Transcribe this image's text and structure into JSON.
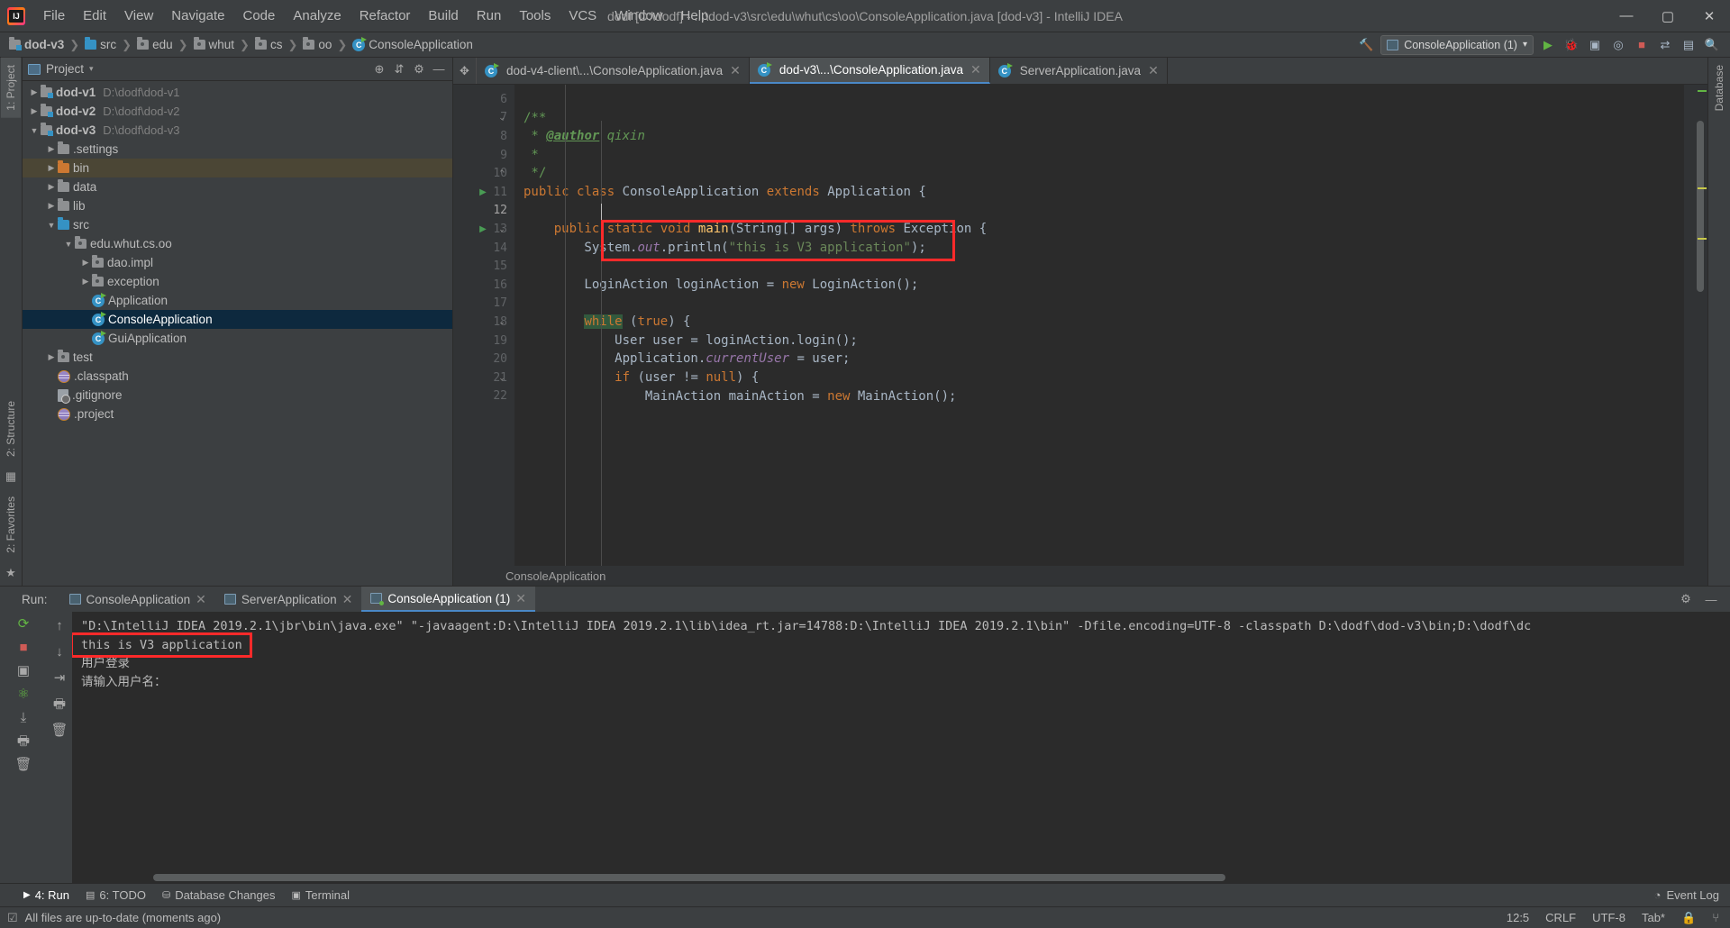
{
  "window": {
    "title": "dodf [D:\\dodf] - ...\\dod-v3\\src\\edu\\whut\\cs\\oo\\ConsoleApplication.java [dod-v3] - IntelliJ IDEA",
    "minimize": "—",
    "maximize": "▢",
    "close": "✕"
  },
  "menu": [
    "File",
    "Edit",
    "View",
    "Navigate",
    "Code",
    "Analyze",
    "Refactor",
    "Build",
    "Run",
    "Tools",
    "VCS",
    "Window",
    "Help"
  ],
  "breadcrumb": {
    "items": [
      {
        "label": "dod-v3",
        "icon": "module-folder-icon"
      },
      {
        "label": "src",
        "icon": "source-folder-icon"
      },
      {
        "label": "edu",
        "icon": "package-folder-icon"
      },
      {
        "label": "whut",
        "icon": "package-folder-icon"
      },
      {
        "label": "cs",
        "icon": "package-folder-icon"
      },
      {
        "label": "oo",
        "icon": "package-folder-icon"
      },
      {
        "label": "ConsoleApplication",
        "icon": "java-class-icon"
      }
    ],
    "separator": "❯"
  },
  "toolbar": {
    "build_icon": "hammer-icon",
    "run_config": "ConsoleApplication (1)",
    "run_config_caret": "▾",
    "icons": [
      "run-icon",
      "debug-icon",
      "coverage-icon",
      "profiler-icon",
      "stop-icon",
      "updates-icon",
      "layout-icon",
      "search-icon"
    ]
  },
  "sidebar_left_tabs": [
    {
      "label": "1: Project",
      "active": true
    },
    {
      "label": "2: Structure",
      "active": false
    },
    {
      "label": "2: Favorites",
      "active": false
    }
  ],
  "sidebar_right_tabs": [
    {
      "label": "Database",
      "active": false
    }
  ],
  "project_panel": {
    "title": "Project",
    "caret": "▾",
    "header_icons": [
      "locate-icon",
      "collapse-all-icon",
      "settings-icon",
      "hide-icon"
    ],
    "tree": [
      {
        "indent": 0,
        "arrow": "▶",
        "icon": "module-folder",
        "label": "dod-v1",
        "bold": true,
        "path": "D:\\dodf\\dod-v1",
        "state": "normal"
      },
      {
        "indent": 0,
        "arrow": "▶",
        "icon": "module-folder",
        "label": "dod-v2",
        "bold": true,
        "path": "D:\\dodf\\dod-v2",
        "state": "normal"
      },
      {
        "indent": 0,
        "arrow": "▼",
        "icon": "module-folder",
        "label": "dod-v3",
        "bold": true,
        "path": "D:\\dodf\\dod-v3",
        "state": "normal"
      },
      {
        "indent": 1,
        "arrow": "▶",
        "icon": "folder",
        "label": ".settings",
        "bold": false,
        "path": "",
        "state": "normal"
      },
      {
        "indent": 1,
        "arrow": "▶",
        "icon": "folder-orange",
        "label": "bin",
        "bold": false,
        "path": "",
        "state": "highlight"
      },
      {
        "indent": 1,
        "arrow": "▶",
        "icon": "folder",
        "label": "data",
        "bold": false,
        "path": "",
        "state": "normal"
      },
      {
        "indent": 1,
        "arrow": "▶",
        "icon": "folder",
        "label": "lib",
        "bold": false,
        "path": "",
        "state": "normal"
      },
      {
        "indent": 1,
        "arrow": "▼",
        "icon": "folder-src",
        "label": "src",
        "bold": false,
        "path": "",
        "state": "normal"
      },
      {
        "indent": 2,
        "arrow": "▼",
        "icon": "package",
        "label": "edu.whut.cs.oo",
        "bold": false,
        "path": "",
        "state": "normal"
      },
      {
        "indent": 3,
        "arrow": "▶",
        "icon": "package",
        "label": "dao.impl",
        "bold": false,
        "path": "",
        "state": "normal"
      },
      {
        "indent": 3,
        "arrow": "▶",
        "icon": "package",
        "label": "exception",
        "bold": false,
        "path": "",
        "state": "normal"
      },
      {
        "indent": 3,
        "arrow": "",
        "icon": "java-class",
        "label": "Application",
        "bold": false,
        "path": "",
        "state": "normal"
      },
      {
        "indent": 3,
        "arrow": "",
        "icon": "java-class",
        "label": "ConsoleApplication",
        "bold": false,
        "path": "",
        "state": "selected"
      },
      {
        "indent": 3,
        "arrow": "",
        "icon": "java-class",
        "label": "GuiApplication",
        "bold": false,
        "path": "",
        "state": "normal"
      },
      {
        "indent": 1,
        "arrow": "▶",
        "icon": "package",
        "label": "test",
        "bold": false,
        "path": "",
        "state": "normal"
      },
      {
        "indent": 1,
        "arrow": "",
        "icon": "jar",
        "label": ".classpath",
        "bold": false,
        "path": "",
        "state": "normal"
      },
      {
        "indent": 1,
        "arrow": "",
        "icon": "file",
        "label": ".gitignore",
        "bold": false,
        "path": "",
        "state": "normal"
      },
      {
        "indent": 1,
        "arrow": "",
        "icon": "jar",
        "label": ".project",
        "bold": false,
        "path": "",
        "state": "normal"
      }
    ]
  },
  "editor": {
    "tabs": [
      {
        "label": "dod-v4-client\\...\\ConsoleApplication.java",
        "active": false,
        "close": "✕"
      },
      {
        "label": "dod-v3\\...\\ConsoleApplication.java",
        "active": true,
        "close": "✕"
      },
      {
        "label": "ServerApplication.java",
        "active": false,
        "close": "✕"
      }
    ],
    "left_icons": [
      "sort-alpha-icon",
      "expand-icon"
    ],
    "line_numbers": [
      "6",
      "7",
      "8",
      "9",
      "10",
      "11",
      "12",
      "13",
      "14",
      "15",
      "16",
      "17",
      "18",
      "19",
      "20",
      "21",
      "22"
    ],
    "current_line": "12",
    "breadcrumb_bottom": "ConsoleApplication",
    "code_lines": [
      {
        "n": "6",
        "text": "",
        "run": false,
        "fold": ""
      },
      {
        "n": "7",
        "text": "/**",
        "run": false,
        "fold": "top"
      },
      {
        "n": "8",
        "text": " * @author qixin",
        "run": false,
        "fold": ""
      },
      {
        "n": "9",
        "text": " *",
        "run": false,
        "fold": ""
      },
      {
        "n": "10",
        "text": " */",
        "run": false,
        "fold": "bottom"
      },
      {
        "n": "11",
        "text": "public class ConsoleApplication extends Application {",
        "run": true,
        "fold": ""
      },
      {
        "n": "12",
        "text": "",
        "run": false,
        "fold": ""
      },
      {
        "n": "13",
        "text": "    public static void main(String[] args) throws Exception {",
        "run": true,
        "fold": "top"
      },
      {
        "n": "14",
        "text": "        System.out.println(\"this is V3 application\");",
        "run": false,
        "fold": ""
      },
      {
        "n": "15",
        "text": "",
        "run": false,
        "fold": ""
      },
      {
        "n": "16",
        "text": "        LoginAction loginAction = new LoginAction();",
        "run": false,
        "fold": ""
      },
      {
        "n": "17",
        "text": "",
        "run": false,
        "fold": ""
      },
      {
        "n": "18",
        "text": "        while (true) {",
        "run": false,
        "fold": "top"
      },
      {
        "n": "19",
        "text": "            User user = loginAction.login();",
        "run": false,
        "fold": ""
      },
      {
        "n": "20",
        "text": "            Application.currentUser = user;",
        "run": false,
        "fold": ""
      },
      {
        "n": "21",
        "text": "            if (user != null) {",
        "run": false,
        "fold": "top"
      },
      {
        "n": "22",
        "text": "                MainAction mainAction = new MainAction();",
        "run": false,
        "fold": ""
      }
    ]
  },
  "run_panel": {
    "label": "Run:",
    "tabs": [
      {
        "label": "ConsoleApplication",
        "active": false,
        "running": false,
        "close": "✕"
      },
      {
        "label": "ServerApplication",
        "active": false,
        "running": false,
        "close": "✕"
      },
      {
        "label": "ConsoleApplication (1)",
        "active": true,
        "running": true,
        "close": "✕"
      }
    ],
    "header_icons": [
      "settings-icon",
      "minimize-icon"
    ],
    "toolbar_left_icons": [
      "rerun-icon",
      "stop-icon",
      "screenshot-icon",
      "thread-dump-icon",
      "export-icon",
      "print-icon",
      "trash-icon"
    ],
    "toolbar_second_icons": [
      "scroll-up-icon",
      "scroll-down-icon",
      "soft-wrap-icon",
      "print-icon",
      "trash-icon"
    ],
    "console_lines": [
      "\"D:\\IntelliJ IDEA 2019.2.1\\jbr\\bin\\java.exe\" \"-javaagent:D:\\IntelliJ IDEA 2019.2.1\\lib\\idea_rt.jar=14788:D:\\IntelliJ IDEA 2019.2.1\\bin\" -Dfile.encoding=UTF-8 -classpath D:\\dodf\\dod-v3\\bin;D:\\dodf\\dc",
      "this is V3 application",
      "用户登录",
      "请输入用户名："
    ],
    "highlighted_line_index": 1
  },
  "bottom_bar": {
    "items": [
      {
        "label": "4: Run",
        "icon": "run-icon",
        "active": true,
        "underline": "4"
      },
      {
        "label": "6: TODO",
        "icon": "todo-icon",
        "active": false,
        "underline": "6"
      },
      {
        "label": "Database Changes",
        "icon": "database-icon",
        "active": false,
        "underline": ""
      },
      {
        "label": "Terminal",
        "icon": "terminal-icon",
        "active": false,
        "underline": ""
      }
    ],
    "event_log": "Event Log",
    "event_log_icon": "event-log-icon"
  },
  "status_bar": {
    "message": "All files are up-to-date (moments ago)",
    "message_icon": "checkmark-icon",
    "caret_position": "12:5",
    "line_separator": "CRLF",
    "encoding": "UTF-8",
    "indent": "Tab*",
    "lock_icon": "lock-icon",
    "branch_icon": "branch-icon"
  },
  "annotations": {
    "editor_box_color": "#ff2a2a",
    "console_box_color": "#ff2a2a"
  }
}
